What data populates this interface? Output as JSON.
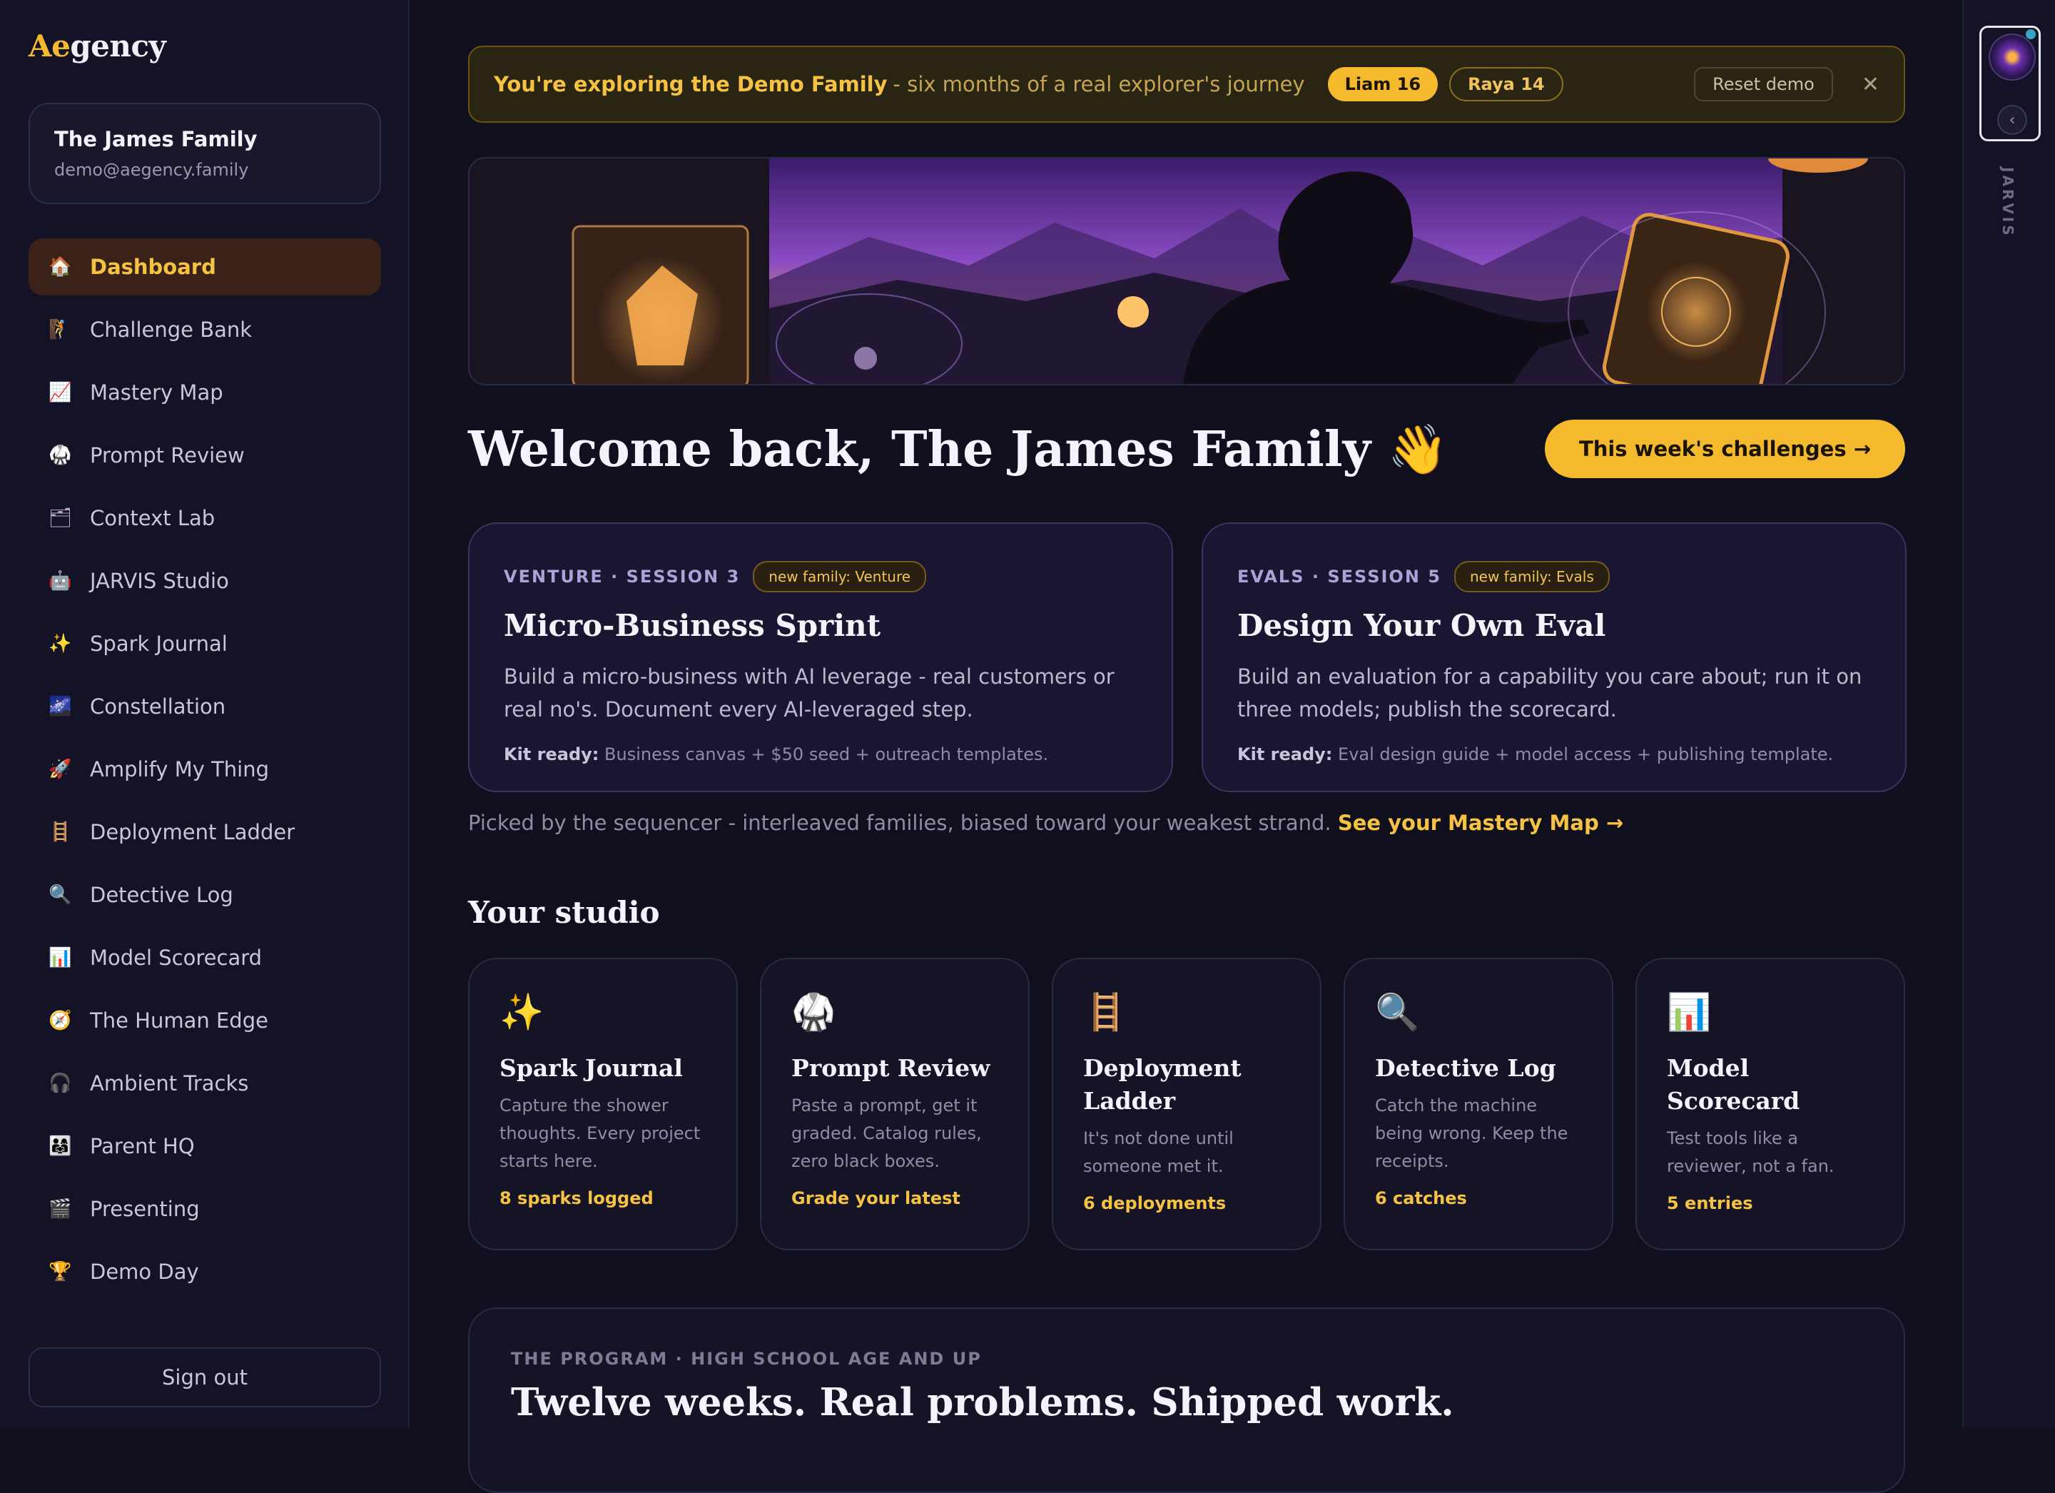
{
  "app": {
    "logo_accent": "Ae",
    "logo_rest": "gency"
  },
  "account": {
    "family_name": "The James Family",
    "email": "demo@aegency.family"
  },
  "nav": [
    {
      "label": "Dashboard",
      "icon": "🏠",
      "icon_name": "house-icon",
      "active": true
    },
    {
      "label": "Challenge Bank",
      "icon": "🧗",
      "icon_name": "climber-icon"
    },
    {
      "label": "Mastery Map",
      "icon": "📈",
      "icon_name": "chart-increasing-icon"
    },
    {
      "label": "Prompt Review",
      "icon": "🥋",
      "icon_name": "martial-arts-uniform-icon"
    },
    {
      "label": "Context Lab",
      "icon": "🗂",
      "icon_name": "card-index-dividers-icon"
    },
    {
      "label": "JARVIS Studio",
      "icon": "🤖",
      "icon_name": "robot-icon"
    },
    {
      "label": "Spark Journal",
      "icon": "✨",
      "icon_name": "sparkles-icon"
    },
    {
      "label": "Constellation",
      "icon": "🌌",
      "icon_name": "milky-way-icon"
    },
    {
      "label": "Amplify My Thing",
      "icon": "🚀",
      "icon_name": "rocket-icon"
    },
    {
      "label": "Deployment Ladder",
      "icon": "🪜",
      "icon_name": "ladder-icon"
    },
    {
      "label": "Detective Log",
      "icon": "🔍",
      "icon_name": "magnifier-icon"
    },
    {
      "label": "Model Scorecard",
      "icon": "📊",
      "icon_name": "bar-chart-icon"
    },
    {
      "label": "The Human Edge",
      "icon": "🧭",
      "icon_name": "compass-icon"
    },
    {
      "label": "Ambient Tracks",
      "icon": "🎧",
      "icon_name": "headphones-icon"
    },
    {
      "label": "Parent HQ",
      "icon": "👨‍👩‍👧",
      "icon_name": "family-icon"
    },
    {
      "label": "Presenting",
      "icon": "🎬",
      "icon_name": "clapper-board-icon"
    },
    {
      "label": "Demo Day",
      "icon": "🏆",
      "icon_name": "trophy-icon"
    }
  ],
  "sign_out_label": "Sign out",
  "rail": {
    "label": "JARVIS",
    "collapse_glyph": "‹"
  },
  "banner": {
    "strong": "You're exploring the Demo Family",
    "sub": "- six months of a real explorer's journey",
    "chips": [
      "Liam 16",
      "Raya 14"
    ],
    "reset_label": "Reset demo",
    "close_glyph": "✕"
  },
  "welcome": {
    "title": "Welcome back, The James Family 👋",
    "cta": "This week's challenges →"
  },
  "challenges": [
    {
      "kicker": "VENTURE · SESSION 3",
      "badge": "new family: Venture",
      "title": "Micro-Business Sprint",
      "desc": "Build a micro-business with AI leverage - real customers or real no's. Document every AI-leveraged step.",
      "kit_label": "Kit ready:",
      "kit": "Business canvas + $50 seed + outreach templates."
    },
    {
      "kicker": "EVALS · SESSION 5",
      "badge": "new family: Evals",
      "title": "Design Your Own Eval",
      "desc": "Build an evaluation for a capability you care about; run it on three models; publish the scorecard.",
      "kit_label": "Kit ready:",
      "kit": "Eval design guide + model access + publishing template."
    }
  ],
  "sequencer": {
    "text": "Picked by the sequencer - interleaved families, biased toward your weakest strand.",
    "link": "See your Mastery Map →"
  },
  "studio": {
    "title": "Your studio",
    "cards": [
      {
        "icon": "✨",
        "icon_name": "sparkles-icon",
        "title": "Spark Journal",
        "desc": "Capture the shower thoughts. Every project starts here.",
        "stat": "8 sparks logged"
      },
      {
        "icon": "🥋",
        "icon_name": "martial-arts-uniform-icon",
        "title": "Prompt Review",
        "desc": "Paste a prompt, get it graded. Catalog rules, zero black boxes.",
        "stat": "Grade your latest"
      },
      {
        "icon": "🪜",
        "icon_name": "ladder-icon",
        "title": "Deployment Ladder",
        "desc": "It's not done until someone met it.",
        "stat": "6 deployments"
      },
      {
        "icon": "🔍",
        "icon_name": "magnifier-icon",
        "title": "Detective Log",
        "desc": "Catch the machine being wrong. Keep the receipts.",
        "stat": "6 catches"
      },
      {
        "icon": "📊",
        "icon_name": "bar-chart-icon",
        "title": "Model Scorecard",
        "desc": "Test tools like a reviewer, not a fan.",
        "stat": "5 entries"
      }
    ]
  },
  "program": {
    "kicker": "THE PROGRAM · HIGH SCHOOL AGE AND UP",
    "title": "Twelve weeks. Real problems. Shipped work."
  },
  "colors": {
    "accent": "#f5b92e",
    "background": "#100f1e",
    "sidebar": "#131226"
  }
}
